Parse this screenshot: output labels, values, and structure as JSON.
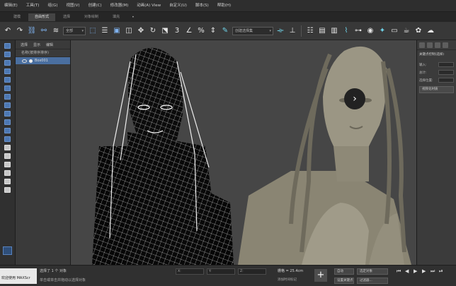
{
  "menu": [
    "编辑(E)",
    "工具(T)",
    "组(G)",
    "视图(V)",
    "创建(C)",
    "修改器(M)",
    "动画(A) View",
    "自定义(U)",
    "脚本(S)",
    "帮助(H)"
  ],
  "ribbon": {
    "tabs": [
      "建模",
      "自由形式",
      "选择",
      "对象绘制",
      "填充"
    ],
    "active": 1,
    "more": "•"
  },
  "toolbar": {
    "selection_filter": "全部",
    "named_selection": "创建选择集"
  },
  "scene_explorer": {
    "tabs": [
      "选择",
      "显示",
      "编辑"
    ],
    "header": "名称(按排序排序)",
    "rows": [
      {
        "label": "Box001",
        "selected": true
      }
    ]
  },
  "command_panel": {
    "title": "关键点控制(选择)",
    "fields": [
      "输入:",
      "总计:",
      "选择位置:"
    ],
    "button": "视频化材质"
  },
  "statusbar": {
    "welcome": "欢迎使用 MAXScr",
    "selection": "选择了 1 个 对象",
    "hint": "单击或单击并拖动以选择对象",
    "x_label": "X:",
    "y_label": "Y:",
    "z_label": "Z:",
    "grid": "栅格 = 25.4cm",
    "time_tag": "添加时间标记",
    "auto_key": "自动",
    "set_key": "设置关键点",
    "filter": "选定对象",
    "key_filters": "过滤器..."
  },
  "colors": {
    "accent": "#4a6fa0",
    "viewport_bg": "#464646",
    "model": "#8f8a78"
  }
}
